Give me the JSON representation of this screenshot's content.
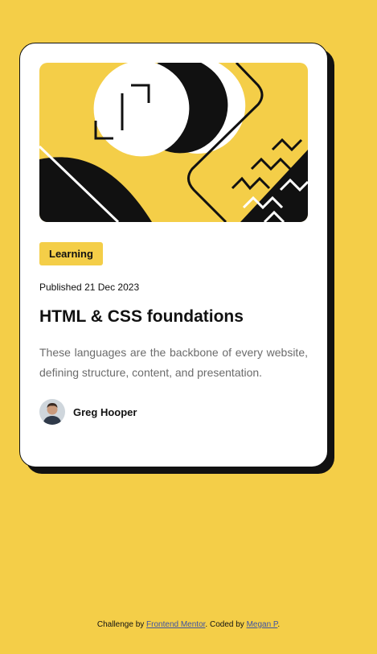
{
  "card": {
    "tag": "Learning",
    "published_prefix": "Published",
    "published_date": "21 Dec 2023",
    "title": "HTML & CSS foundations",
    "description": "These languages are the backbone of every website, defining structure, content, and presentation.",
    "author_name": "Greg Hooper"
  },
  "footer": {
    "prefix": "Challenge by",
    "challenge_link": "Frontend Mentor",
    "middle": ". Coded by",
    "author_link": "Megan P",
    "suffix": "."
  },
  "colors": {
    "background": "#f4ce48",
    "card": "#ffffff",
    "ink": "#111111",
    "muted_text": "#6b6b6b",
    "link": "#3e52a3"
  },
  "icons": {
    "hero": "abstract-illustration",
    "avatar": "author-avatar"
  }
}
